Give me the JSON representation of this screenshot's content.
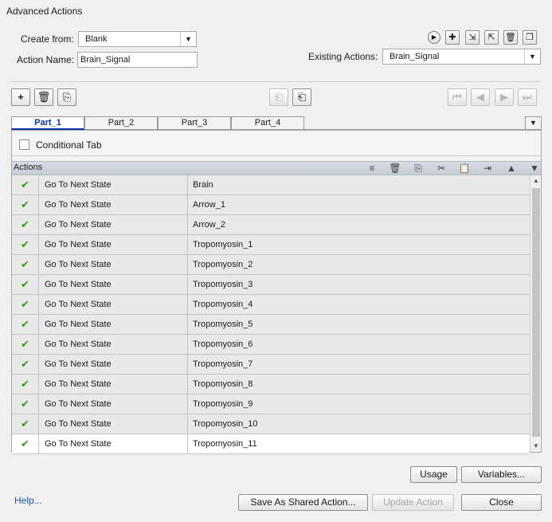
{
  "window": {
    "title": "Advanced Actions"
  },
  "form": {
    "create_from_label": "Create from:",
    "create_from_value": "Blank",
    "action_name_label": "Action Name:",
    "action_name_value": "Brain_Signal",
    "existing_actions_label": "Existing Actions:",
    "existing_actions_value": "Brain_Signal"
  },
  "tabs": [
    {
      "label": "Part_1",
      "active": true
    },
    {
      "label": "Part_2",
      "active": false
    },
    {
      "label": "Part_3",
      "active": false
    },
    {
      "label": "Part_4",
      "active": false
    }
  ],
  "conditional_tab_label": "Conditional Tab",
  "actions_header": "Actions",
  "actions": [
    {
      "action": "Go To Next State",
      "target": "Brain"
    },
    {
      "action": "Go To Next State",
      "target": "Arrow_1"
    },
    {
      "action": "Go To Next State",
      "target": "Arrow_2"
    },
    {
      "action": "Go To Next State",
      "target": "Tropomyosin_1"
    },
    {
      "action": "Go To Next State",
      "target": "Tropomyosin_2"
    },
    {
      "action": "Go To Next State",
      "target": "Tropomyosin_3"
    },
    {
      "action": "Go To Next State",
      "target": "Tropomyosin_4"
    },
    {
      "action": "Go To Next State",
      "target": "Tropomyosin_5"
    },
    {
      "action": "Go To Next State",
      "target": "Tropomyosin_6"
    },
    {
      "action": "Go To Next State",
      "target": "Tropomyosin_7"
    },
    {
      "action": "Go To Next State",
      "target": "Tropomyosin_8"
    },
    {
      "action": "Go To Next State",
      "target": "Tropomyosin_9"
    },
    {
      "action": "Go To Next State",
      "target": "Tropomyosin_10"
    },
    {
      "action": "Go To Next State",
      "target": "Tropomyosin_11"
    }
  ],
  "buttons": {
    "usage": "Usage",
    "variables": "Variables...",
    "save_shared": "Save As Shared Action...",
    "update_action": "Update Action",
    "close": "Close",
    "help": "Help..."
  },
  "icons": {
    "preview": "play-icon",
    "add": "plus-icon",
    "delete": "trash-icon",
    "check": "check-icon"
  },
  "colors": {
    "accent": "#0a35a8",
    "check": "#3a9a1a",
    "help_link": "#1b58b0"
  }
}
